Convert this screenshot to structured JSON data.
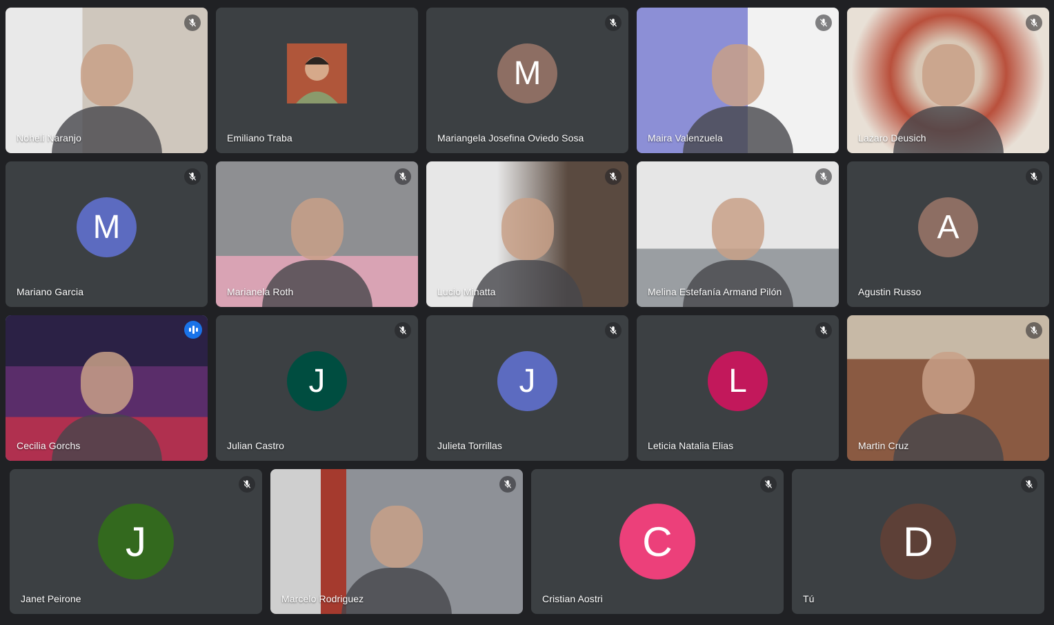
{
  "participants": [
    {
      "name": "Noheli Naranjo",
      "muted": true,
      "video": true,
      "scene": "room-shelves"
    },
    {
      "name": "Emiliano Traba",
      "muted": false,
      "video": false,
      "avatar_photo": true,
      "avatar_color": "#a0522d"
    },
    {
      "name": "Mariangela Josefina Oviedo Sosa",
      "muted": true,
      "video": false,
      "initial": "M",
      "avatar_color": "#8d6e63"
    },
    {
      "name": "Maira Valenzuela",
      "muted": true,
      "video": true,
      "scene": "window-lilac"
    },
    {
      "name": "Lazaro Deusich",
      "muted": true,
      "video": true,
      "scene": "warm-blur"
    },
    {
      "name": "Mariano Garcia",
      "muted": true,
      "video": false,
      "initial": "M",
      "avatar_color": "#5c6bc0"
    },
    {
      "name": "Marianela Roth",
      "muted": true,
      "video": true,
      "scene": "grey-pink"
    },
    {
      "name": "Lucio Minatta",
      "muted": true,
      "video": true,
      "scene": "orange-hoodie"
    },
    {
      "name": "Melina Estefanía Armand Pilón",
      "muted": true,
      "video": true,
      "scene": "light-grey"
    },
    {
      "name": "Agustin Russo",
      "muted": true,
      "video": false,
      "initial": "A",
      "avatar_color": "#8d6e63"
    },
    {
      "name": "Cecilia Gorchs",
      "muted": false,
      "speaking": true,
      "video": true,
      "scene": "night-garden"
    },
    {
      "name": "Julian Castro",
      "muted": true,
      "video": false,
      "initial": "J",
      "avatar_color": "#004d40"
    },
    {
      "name": "Julieta Torrillas",
      "muted": true,
      "video": false,
      "initial": "J",
      "avatar_color": "#5c6bc0"
    },
    {
      "name": "Leticia Natalia Elias",
      "muted": true,
      "video": false,
      "initial": "L",
      "avatar_color": "#c2185b"
    },
    {
      "name": "Martin Cruz",
      "muted": true,
      "video": true,
      "scene": "brown-blur"
    },
    {
      "name": "Janet Peirone",
      "muted": true,
      "video": false,
      "initial": "J",
      "avatar_color": "#33691e"
    },
    {
      "name": "Marcelo Rodriguez",
      "muted": true,
      "video": true,
      "scene": "gaming-chair"
    },
    {
      "name": "Cristian Aostri",
      "muted": true,
      "video": false,
      "initial": "C",
      "avatar_color": "#ec407a"
    },
    {
      "name": "Tú",
      "muted": true,
      "video": false,
      "initial": "D",
      "avatar_color": "#5d4037"
    }
  ],
  "icons": {
    "muted": "mic-off-icon",
    "speaking": "audio-level-icon"
  }
}
